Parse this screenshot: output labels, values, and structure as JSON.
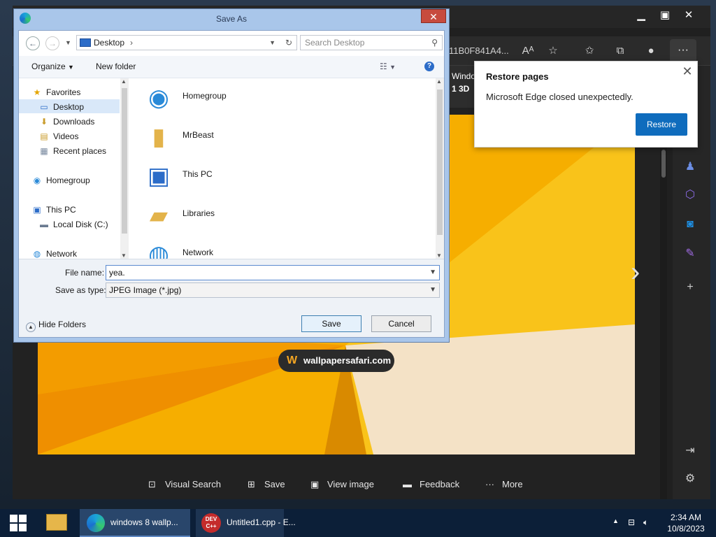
{
  "dialog": {
    "title": "Save As",
    "address": "Desktop",
    "search_placeholder": "Search Desktop",
    "toolbar": {
      "organize": "Organize",
      "new_folder": "New folder"
    },
    "nav_pane": {
      "favorites": "Favorites",
      "desktop": "Desktop",
      "downloads": "Downloads",
      "videos": "Videos",
      "recent": "Recent places",
      "homegroup": "Homegroup",
      "this_pc": "This PC",
      "local_disk": "Local Disk (C:)",
      "network": "Network"
    },
    "files": [
      "Homegroup",
      "MrBeast",
      "This PC",
      "Libraries",
      "Network"
    ],
    "file_name_label": "File name:",
    "file_name_value": "yea.",
    "save_type_label": "Save as type:",
    "save_type_value": "JPEG Image (*.jpg)",
    "hide_folders": "Hide Folders",
    "save_button": "Save",
    "cancel_button": "Cancel"
  },
  "edge": {
    "url_fragment": "11B0F841A4...",
    "tab_header_line1": "Windo",
    "tab_header_line2": "1 3D",
    "restore_popup": {
      "title": "Restore pages",
      "message": "Microsoft Edge closed unexpectedly.",
      "button": "Restore"
    },
    "watermark": "wallpapersafari.com",
    "actions": {
      "visual_search": "Visual Search",
      "save": "Save",
      "view_image": "View image",
      "feedback": "Feedback",
      "more": "More"
    }
  },
  "taskbar": {
    "edge_item": "windows 8 wallp...",
    "devcpp_item": "Untitled1.cpp - E...",
    "time": "2:34 AM",
    "date": "10/8/2023"
  },
  "colors": {
    "accent_blue": "#0f6cbd",
    "wallpaper_orange": "#f4a800",
    "close_red": "#c74b3e"
  }
}
